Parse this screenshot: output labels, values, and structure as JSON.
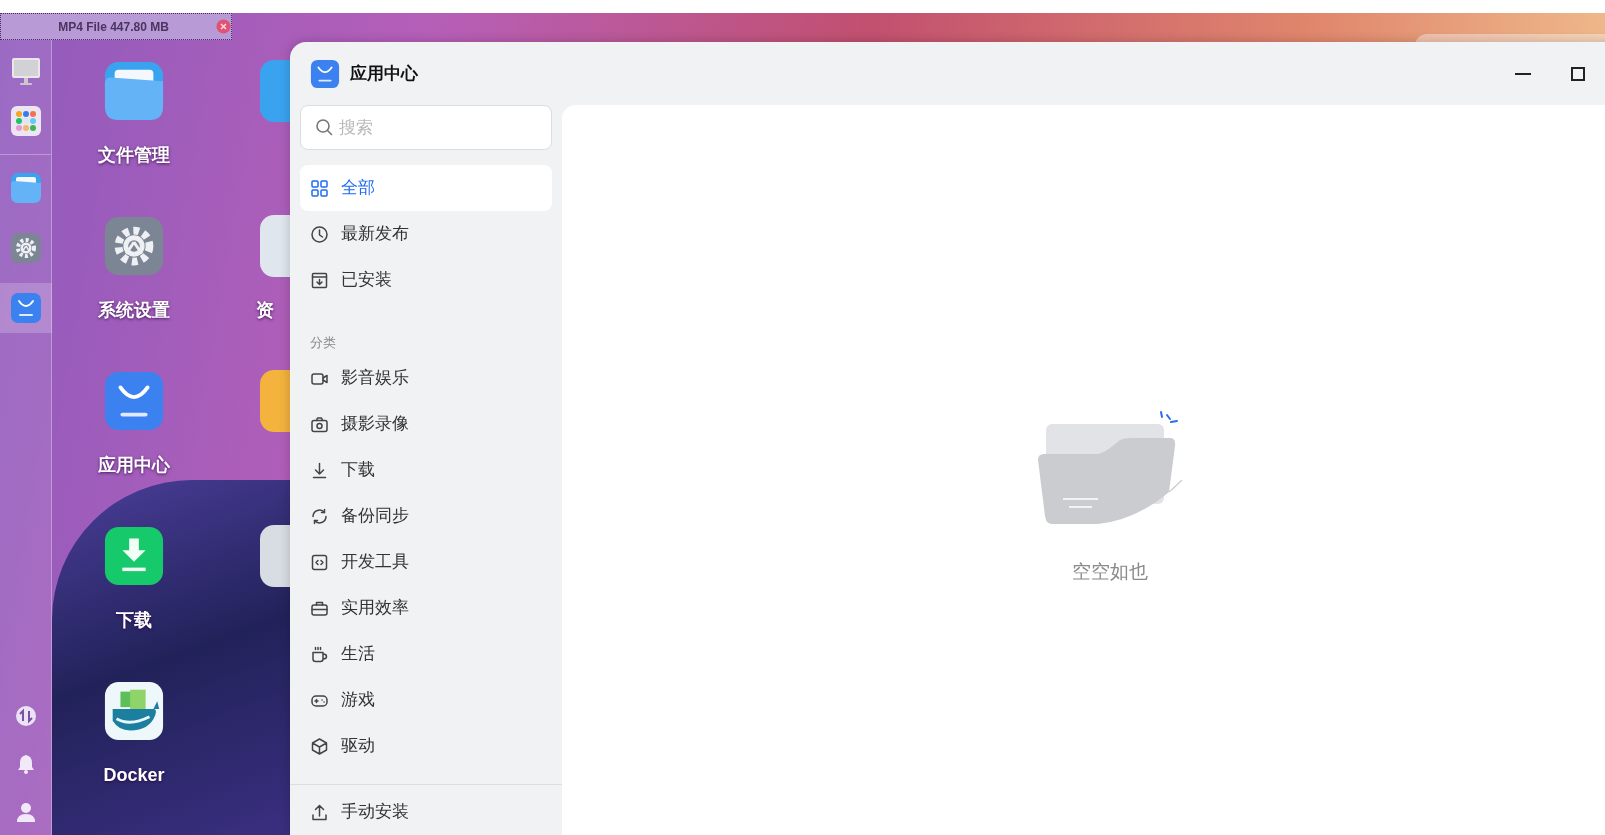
{
  "file_tag": {
    "text": "MP4 File 447.80 MB"
  },
  "dock": {
    "top": [
      {
        "kind": "monitor",
        "selected": false
      },
      {
        "kind": "apps",
        "selected": false
      }
    ],
    "pinned": [
      {
        "kind": "files",
        "selected": false
      },
      {
        "kind": "settings",
        "selected": false
      },
      {
        "kind": "store",
        "selected": true
      }
    ],
    "bottom": [
      {
        "kind": "updown"
      },
      {
        "kind": "bell"
      },
      {
        "kind": "user"
      }
    ]
  },
  "desktop": {
    "apps": [
      {
        "kind": "files",
        "label": "文件管理"
      },
      {
        "kind": "settings",
        "label": "系统设置"
      },
      {
        "kind": "store",
        "label": "应用中心"
      },
      {
        "kind": "download",
        "label": "下载"
      },
      {
        "kind": "docker",
        "label": "Docker"
      }
    ],
    "column_2": [
      {
        "kind": "blue"
      },
      {
        "kind": "teal",
        "label": "资"
      },
      {
        "kind": "orange"
      },
      {
        "kind": "grey"
      }
    ]
  },
  "window": {
    "title": "应用中心",
    "search": {
      "placeholder": "搜索"
    },
    "nav": [
      {
        "kind": "grid",
        "label": "全部",
        "selected": true
      },
      {
        "kind": "clock",
        "label": "最新发布",
        "selected": false
      },
      {
        "kind": "installed",
        "label": "已安装",
        "selected": false
      }
    ],
    "section_label": "分类",
    "categories": [
      {
        "kind": "video",
        "label": "影音娱乐",
        "selected": false
      },
      {
        "kind": "camera",
        "label": "摄影录像",
        "selected": false
      },
      {
        "kind": "download",
        "label": "下载",
        "selected": false
      },
      {
        "kind": "sync",
        "label": "备份同步",
        "selected": false
      },
      {
        "kind": "code",
        "label": "开发工具",
        "selected": false
      },
      {
        "kind": "briefcase",
        "label": "实用效率",
        "selected": false
      },
      {
        "kind": "cup",
        "label": "生活",
        "selected": false
      },
      {
        "kind": "gamepad",
        "label": "游戏",
        "selected": false
      },
      {
        "kind": "cube",
        "label": "驱动",
        "selected": false
      }
    ],
    "footer_action": {
      "kind": "upload",
      "label": "手动安装"
    },
    "empty_state": {
      "text": "空空如也"
    }
  }
}
